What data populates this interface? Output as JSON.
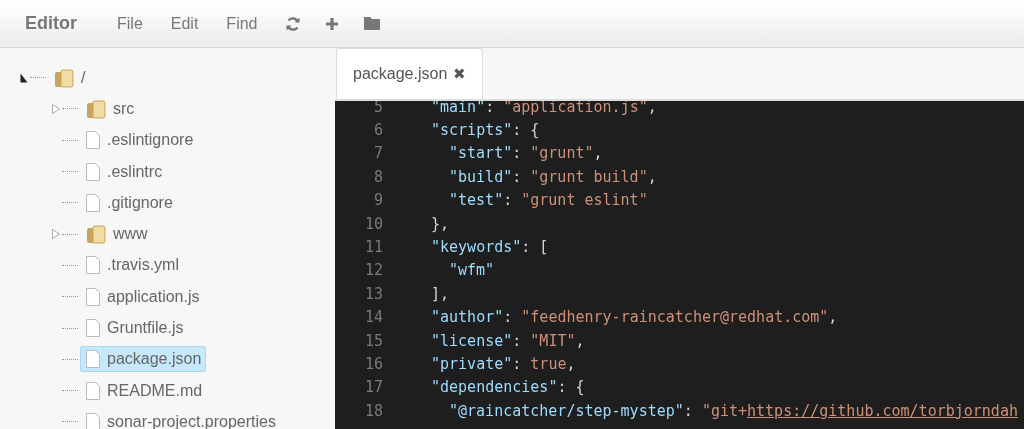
{
  "header": {
    "title": "Editor",
    "menu": [
      "File",
      "Edit",
      "Find"
    ],
    "tools": [
      {
        "kind": "refresh"
      },
      {
        "kind": "add"
      },
      {
        "kind": "folder"
      }
    ]
  },
  "tree": [
    {
      "name": "/",
      "kind": "folder",
      "expanded": true,
      "selected": false,
      "children": [
        {
          "name": "src",
          "kind": "folder",
          "expanded": false,
          "selected": false
        },
        {
          "name": ".eslintignore",
          "kind": "file",
          "selected": false
        },
        {
          "name": ".eslintrc",
          "kind": "file",
          "selected": false
        },
        {
          "name": ".gitignore",
          "kind": "file",
          "selected": false
        },
        {
          "name": "www",
          "kind": "folder",
          "expanded": false,
          "selected": false
        },
        {
          "name": ".travis.yml",
          "kind": "file",
          "selected": false
        },
        {
          "name": "application.js",
          "kind": "file",
          "selected": false
        },
        {
          "name": "Gruntfile.js",
          "kind": "file",
          "selected": false
        },
        {
          "name": "package.json",
          "kind": "file",
          "selected": true
        },
        {
          "name": "README.md",
          "kind": "file",
          "selected": false
        },
        {
          "name": "sonar-project.properties",
          "kind": "file",
          "selected": false
        }
      ]
    }
  ],
  "tabs": [
    {
      "label": "package.json",
      "close": "✖",
      "selected": true
    }
  ],
  "code": [
    {
      "number": "5",
      "inner": false,
      "tokens": [
        {
          "kind": "key",
          "text": "\"main\""
        },
        {
          "kind": "punct",
          "text": ": "
        },
        {
          "kind": "string",
          "text": "\"application.js\""
        },
        {
          "kind": "punct",
          "text": ","
        }
      ]
    },
    {
      "number": "6",
      "inner": false,
      "tokens": [
        {
          "kind": "key",
          "text": "\"scripts\""
        },
        {
          "kind": "punct",
          "text": ": {"
        }
      ]
    },
    {
      "number": "7",
      "inner": true,
      "tokens": [
        {
          "kind": "key",
          "text": "\"start\""
        },
        {
          "kind": "punct",
          "text": ": "
        },
        {
          "kind": "string",
          "text": "\"grunt\""
        },
        {
          "kind": "punct",
          "text": ","
        }
      ]
    },
    {
      "number": "8",
      "inner": true,
      "tokens": [
        {
          "kind": "key",
          "text": "\"build\""
        },
        {
          "kind": "punct",
          "text": ": "
        },
        {
          "kind": "string",
          "text": "\"grunt build\""
        },
        {
          "kind": "punct",
          "text": ","
        }
      ]
    },
    {
      "number": "9",
      "inner": true,
      "tokens": [
        {
          "kind": "key",
          "text": "\"test\""
        },
        {
          "kind": "punct",
          "text": ": "
        },
        {
          "kind": "string",
          "text": "\"grunt eslint\""
        }
      ]
    },
    {
      "number": "10",
      "inner": false,
      "tokens": [
        {
          "kind": "punct",
          "text": "},"
        }
      ]
    },
    {
      "number": "11",
      "inner": false,
      "tokens": [
        {
          "kind": "key",
          "text": "\"keywords\""
        },
        {
          "kind": "punct",
          "text": ": ["
        }
      ]
    },
    {
      "number": "12",
      "inner": true,
      "tokens": [
        {
          "kind": "key",
          "text": "\"wfm\""
        }
      ]
    },
    {
      "number": "13",
      "inner": false,
      "tokens": [
        {
          "kind": "punct",
          "text": "],"
        }
      ]
    },
    {
      "number": "14",
      "inner": false,
      "tokens": [
        {
          "kind": "key",
          "text": "\"author\""
        },
        {
          "kind": "punct",
          "text": ": "
        },
        {
          "kind": "string",
          "text": "\"feedhenry-raincatcher@redhat.com\""
        },
        {
          "kind": "punct",
          "text": ","
        }
      ]
    },
    {
      "number": "15",
      "inner": false,
      "tokens": [
        {
          "kind": "key",
          "text": "\"license\""
        },
        {
          "kind": "punct",
          "text": ": "
        },
        {
          "kind": "string",
          "text": "\"MIT\""
        },
        {
          "kind": "punct",
          "text": ","
        }
      ]
    },
    {
      "number": "16",
      "inner": false,
      "tokens": [
        {
          "kind": "key",
          "text": "\"private\""
        },
        {
          "kind": "punct",
          "text": ": "
        },
        {
          "kind": "string",
          "text": "true"
        },
        {
          "kind": "punct",
          "text": ","
        }
      ]
    },
    {
      "number": "17",
      "inner": false,
      "tokens": [
        {
          "kind": "key",
          "text": "\"dependencies\""
        },
        {
          "kind": "punct",
          "text": ": {"
        }
      ]
    },
    {
      "number": "18",
      "inner": true,
      "tokens": [
        {
          "kind": "key",
          "text": "\"@raincatcher/step-mystep\""
        },
        {
          "kind": "punct",
          "text": ": "
        },
        {
          "kind": "string",
          "text": "\"git+"
        },
        {
          "kind": "link",
          "text": "https://github.com/torbjorndah"
        }
      ]
    }
  ]
}
